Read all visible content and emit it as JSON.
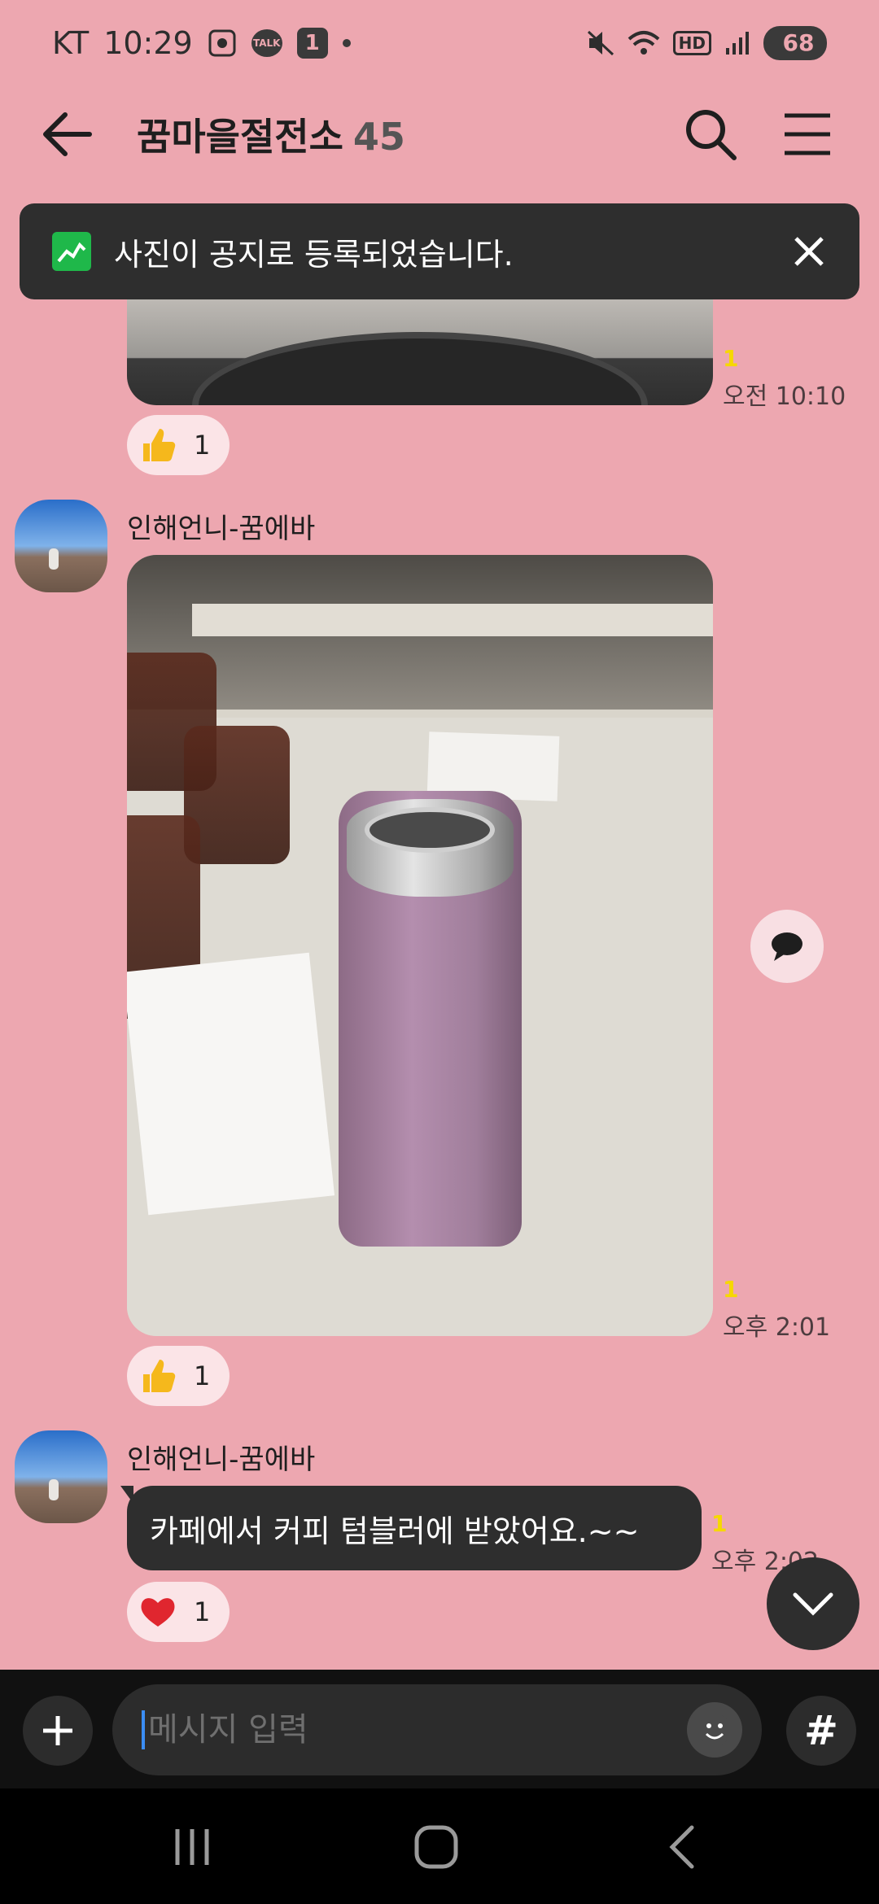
{
  "status_bar": {
    "carrier": "KT",
    "time": "10:29",
    "talk_badge": "TALK",
    "notification_count": "1",
    "network_label": "HD",
    "battery": "68"
  },
  "header": {
    "title": "꿈마을절전소",
    "member_count": "45"
  },
  "notice_toast": {
    "text": "사진이 공지로 등록되었습니다."
  },
  "messages": [
    {
      "type": "image",
      "read_count": "1",
      "time": "오전 10:10",
      "reaction": {
        "icon": "thumbs-up-icon",
        "count": "1"
      }
    },
    {
      "type": "image",
      "sender": "인해언니-꿈에바",
      "read_count": "1",
      "time": "오후 2:01",
      "reaction": {
        "icon": "thumbs-up-icon",
        "count": "1"
      }
    },
    {
      "type": "text",
      "sender": "인해언니-꿈에바",
      "text": "카페에서 커피 텀블러에 받았어요.~~",
      "read_count": "1",
      "time": "오후 2:02",
      "reaction": {
        "icon": "heart-icon",
        "count": "1"
      }
    }
  ],
  "input_bar": {
    "placeholder": "메시지 입력",
    "hash_label": "#"
  },
  "colors": {
    "background": "#eda7b0",
    "bubble": "#2e2e2e",
    "read_count": "#f6d800",
    "notice_icon": "#1fb84a"
  }
}
